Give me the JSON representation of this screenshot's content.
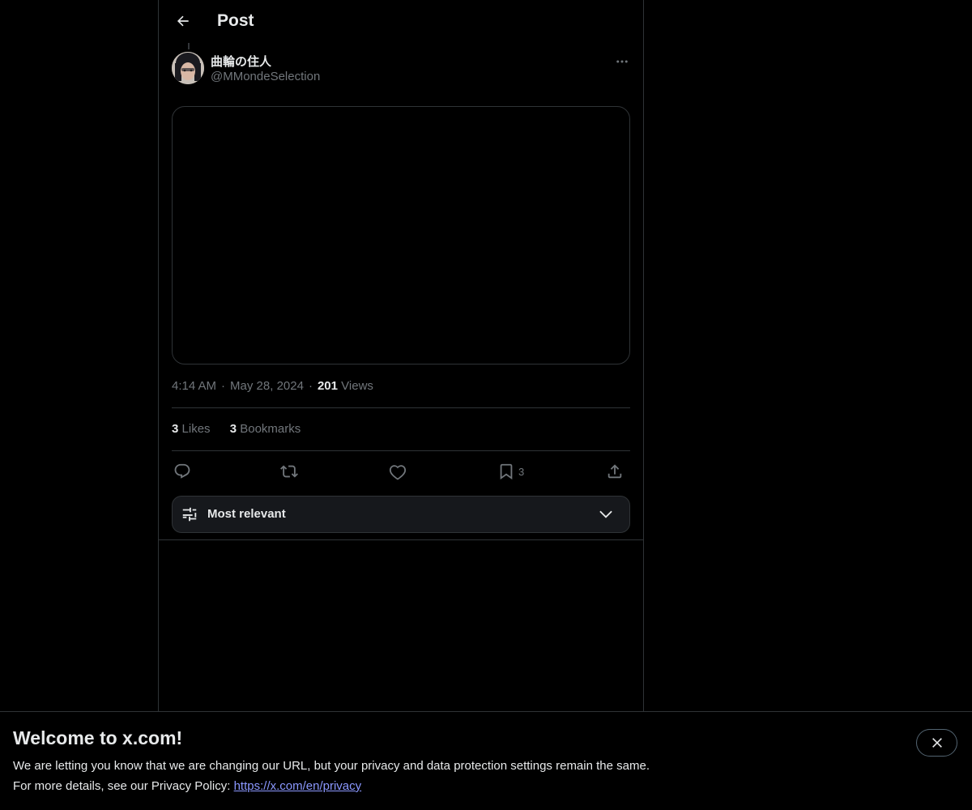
{
  "header": {
    "title": "Post",
    "back_icon": "arrow-left-icon"
  },
  "post": {
    "author": {
      "display_name": "曲輪の住人",
      "handle": "@MMondeSelection"
    },
    "time": "4:14 AM",
    "date": "May 28, 2024",
    "views_count": "201",
    "views_label": "Views",
    "likes_count": "3",
    "likes_label": "Likes",
    "bookmarks_count": "3",
    "bookmarks_label": "Bookmarks",
    "actions": {
      "reply_icon": "reply-icon",
      "repost_icon": "repost-icon",
      "like_icon": "heart-icon",
      "bookmark_icon": "bookmark-icon",
      "bookmark_count": "3",
      "share_icon": "share-icon"
    }
  },
  "replies_sort": {
    "label": "Most relevant",
    "icon": "sliders-icon",
    "chevron": "chevron-down-icon"
  },
  "banner": {
    "title": "Welcome to x.com!",
    "line1": "We are letting you know that we are changing our URL, but your privacy and data protection settings remain the same.",
    "line2_prefix": "For more details, see our Privacy Policy: ",
    "privacy_link": "https://x.com/en/privacy",
    "close_icon": "close-icon"
  },
  "colors": {
    "background": "#000000",
    "text_primary": "#e7e9ea",
    "text_secondary": "#71767b",
    "border": "#2f3336",
    "link": "#8b98ff"
  }
}
